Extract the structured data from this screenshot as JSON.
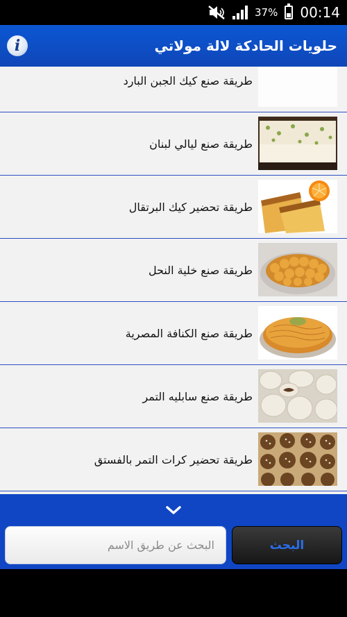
{
  "status_bar": {
    "battery": "37%",
    "time": "00:14",
    "battery_level": 0.37
  },
  "app_bar": {
    "title": "حلويات الحادكة لالة مولاتي",
    "info_icon": "info-icon"
  },
  "recipes": [
    {
      "title": "طريقة صنع كيك الجبن البارد"
    },
    {
      "title": "طريقة صنع ليالي لبنان"
    },
    {
      "title": "طريقة تحضير كيك البرتقال"
    },
    {
      "title": "طريقة صنع خلية النحل"
    },
    {
      "title": "طريقة صنع الكنافة المصرية"
    },
    {
      "title": "طريقة صنع سابليه التمر"
    },
    {
      "title": "طريقة تحضير كرات التمر بالفستق"
    }
  ],
  "search": {
    "placeholder": "البحث عن طريق الاسم",
    "button_label": "البحث"
  },
  "colors": {
    "app_bar": "#0b57d3",
    "bottom_bar": "#1046c4",
    "divider": "#2c4fc4",
    "list_bg": "#f2f2f2"
  }
}
